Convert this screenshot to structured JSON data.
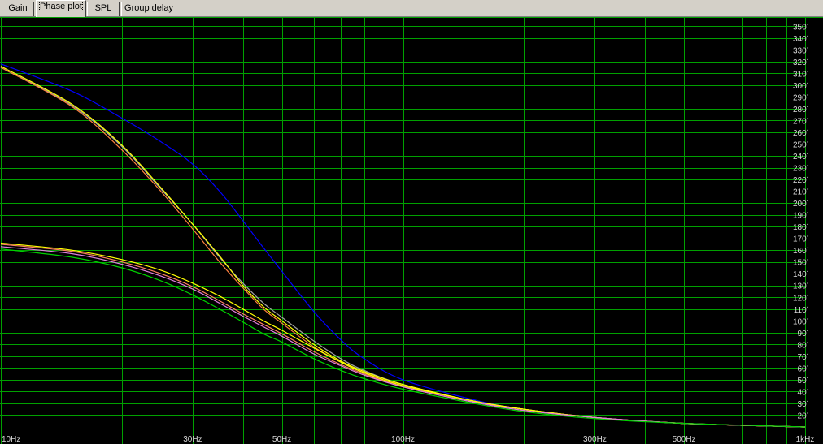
{
  "tabs": [
    {
      "label": "Gain",
      "active": false
    },
    {
      "label": "Phase plot",
      "active": true
    },
    {
      "label": "SPL",
      "active": false
    },
    {
      "label": "Group delay",
      "active": false
    }
  ],
  "colors": {
    "background": "#000000",
    "grid": "#00a000",
    "axis_text": "#d8d8d8"
  },
  "chart_data": {
    "type": "line",
    "title": "",
    "xlabel": "",
    "ylabel": "",
    "x_scale": "log",
    "xlim": [
      10,
      1000
    ],
    "ylim": [
      10,
      355
    ],
    "grid": true,
    "x_tick_labels": [
      {
        "value": 10,
        "label": "10Hz"
      },
      {
        "value": 30,
        "label": "30Hz"
      },
      {
        "value": 50,
        "label": "50Hz"
      },
      {
        "value": 100,
        "label": "100Hz"
      },
      {
        "value": 300,
        "label": "300Hz"
      },
      {
        "value": 500,
        "label": "500Hz"
      },
      {
        "value": 1000,
        "label": "1kHz"
      }
    ],
    "y_ticks": [
      20,
      30,
      40,
      50,
      60,
      70,
      80,
      90,
      100,
      110,
      120,
      130,
      140,
      150,
      160,
      170,
      180,
      190,
      200,
      210,
      220,
      230,
      240,
      250,
      260,
      270,
      280,
      290,
      300,
      310,
      320,
      330,
      340,
      350
    ],
    "y_tick_suffix": "´",
    "series": [
      {
        "color": "#0000ff",
        "x": [
          10,
          15,
          20,
          25,
          30,
          35,
          40,
          45,
          50,
          60,
          70,
          80,
          100,
          150,
          200,
          300,
          500,
          1000
        ],
        "y": [
          318,
          295,
          272,
          252,
          233,
          210,
          185,
          162,
          142,
          108,
          84,
          68,
          50,
          33,
          25,
          18,
          13,
          10
        ]
      },
      {
        "color": "#a0a0a0",
        "x": [
          10,
          15,
          20,
          25,
          30,
          35,
          40,
          45,
          50,
          60,
          70,
          80,
          100,
          150,
          200,
          300,
          500,
          1000
        ],
        "y": [
          315,
          283,
          248,
          212,
          182,
          154,
          132,
          115,
          103,
          83,
          68,
          58,
          46,
          32,
          25,
          18,
          13,
          10
        ]
      },
      {
        "color": "#ff8040",
        "x": [
          10,
          15,
          20,
          25,
          30,
          35,
          40,
          45,
          50,
          60,
          70,
          80,
          100,
          150,
          200,
          300,
          500,
          1000
        ],
        "y": [
          315,
          282,
          245,
          210,
          178,
          150,
          128,
          110,
          98,
          78,
          65,
          56,
          45,
          32,
          25,
          18,
          13,
          10
        ]
      },
      {
        "color": "#ffff00",
        "x": [
          10,
          15,
          20,
          25,
          30,
          35,
          40,
          45,
          50,
          60,
          70,
          80,
          100,
          150,
          200,
          300,
          500,
          1000
        ],
        "y": [
          316,
          284,
          249,
          213,
          182,
          155,
          130,
          112,
          100,
          80,
          66,
          57,
          46,
          32,
          25,
          18,
          13,
          10
        ]
      },
      {
        "color": "#ffff00",
        "x": [
          10,
          15,
          20,
          25,
          30,
          35,
          40,
          45,
          50,
          60,
          70,
          80,
          100,
          150,
          200,
          300,
          500,
          1000
        ],
        "y": [
          166,
          160,
          152,
          143,
          132,
          121,
          110,
          100,
          92,
          77,
          65,
          56,
          45,
          32,
          25,
          18,
          13,
          10
        ]
      },
      {
        "color": "#ff8060",
        "x": [
          10,
          15,
          20,
          25,
          30,
          35,
          40,
          45,
          50,
          60,
          70,
          80,
          100,
          150,
          200,
          300,
          500,
          1000
        ],
        "y": [
          165,
          159,
          150,
          140,
          129,
          117,
          106,
          97,
          89,
          74,
          63,
          55,
          44,
          31,
          24,
          18,
          13,
          10
        ]
      },
      {
        "color": "#e080e0",
        "x": [
          10,
          15,
          20,
          25,
          30,
          35,
          40,
          45,
          50,
          60,
          70,
          80,
          100,
          150,
          200,
          300,
          500,
          1000
        ],
        "y": [
          163,
          157,
          148,
          138,
          127,
          115,
          104,
          95,
          87,
          72,
          62,
          54,
          44,
          31,
          24,
          18,
          13,
          10
        ]
      },
      {
        "color": "#00d000",
        "x": [
          10,
          15,
          20,
          25,
          30,
          35,
          40,
          45,
          50,
          60,
          70,
          80,
          100,
          150,
          200,
          300,
          500,
          1000
        ],
        "y": [
          161,
          154,
          145,
          134,
          122,
          110,
          99,
          89,
          82,
          68,
          58,
          51,
          42,
          30,
          23,
          17,
          13,
          10
        ]
      }
    ]
  }
}
